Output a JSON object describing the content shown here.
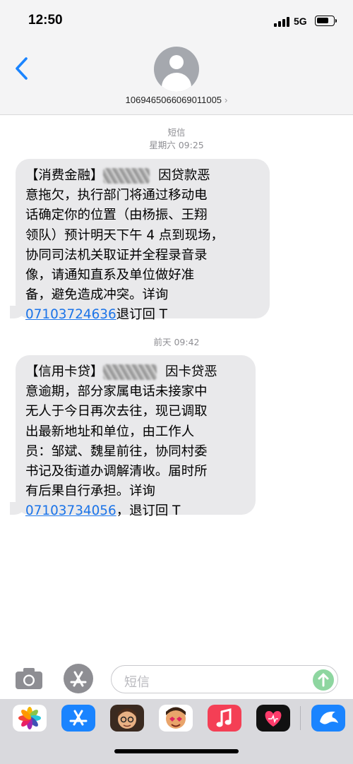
{
  "status_bar": {
    "time": "12:50",
    "network": "5G"
  },
  "header": {
    "back_icon": "chevron-left-icon",
    "contact_number": "1069465066069011005",
    "chevron": "›"
  },
  "messages": [
    {
      "label": "短信",
      "timestamp": "星期六 09:25",
      "line1_prefix": "【消费金融】",
      "line1_suffix": "因贷款恶",
      "body": "意拖欠，执行部门将通过移动电\n话确定你的位置（由杨振、王翔\n领队）预计明天下午 4 点到现场，\n协同司法机关取证并全程录音录\n像，请通知直系及单位做好准\n备，避免造成冲突。详询\n",
      "phone": "07103724636",
      "tail": "退订回 T"
    },
    {
      "timestamp": "前天 09:42",
      "line1_prefix": "【信用卡贷】",
      "line1_suffix": "因卡贷恶",
      "body": "意逾期，部分家属电话未接家中\n无人于今日再次去往，现已调取\n出最新地址和单位，由工作人\n员：邹斌、魏星前往，协同村委\n书记及街道办调解清收。届时所\n有后果自行承担。详询\n",
      "phone": "07103734056",
      "tail": "，退订回 T"
    }
  ],
  "compose": {
    "placeholder": "短信"
  },
  "drawer": {
    "apps": [
      "photos-icon",
      "app-store-icon",
      "memoji-icon",
      "memoji-stickers-icon",
      "music-icon",
      "heart-app-icon",
      "dolphin-app-icon"
    ]
  },
  "colors": {
    "bubble": "#e9e9eb",
    "link": "#1a73e8",
    "accent": "#1a84ff"
  }
}
